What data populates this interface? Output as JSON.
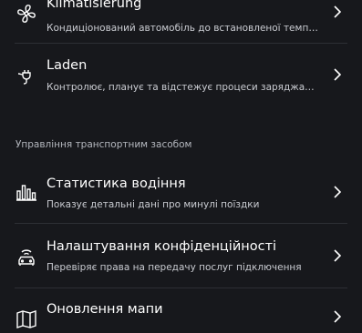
{
  "items": [
    {
      "title": "Klimatisierung",
      "subtitle": "Кондиціонований автомобіль до встановленої температури",
      "icon": "fan-icon"
    },
    {
      "title": "Laden",
      "subtitle": "Контролює, планує та відстежує процеси заряджання",
      "icon": "charging-plug-icon"
    }
  ],
  "section_label": "Управління транспортним засобом",
  "vehicle_items": [
    {
      "title": "Статистика водіння",
      "subtitle": "Показує детальні дані про минулі поїздки",
      "icon": "bar-chart-icon"
    },
    {
      "title": "Налаштування конфіденційності",
      "subtitle": "Перевіряє права на передачу послуг підключення",
      "icon": "connected-car-icon"
    },
    {
      "title": "Оновлення мапи",
      "subtitle": "",
      "icon": "map-icon"
    }
  ]
}
